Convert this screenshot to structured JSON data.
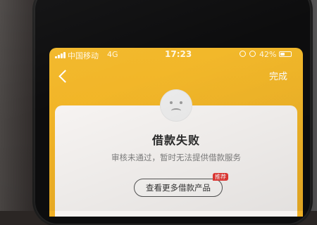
{
  "status_bar": {
    "carrier": "中国移动",
    "network": "4G",
    "time": "17:23",
    "battery_percent": "42%",
    "battery_level": 0.42
  },
  "nav": {
    "back_icon": "chevron-left",
    "done_label": "完成"
  },
  "result": {
    "icon": "sad-face",
    "title": "借款失败",
    "message": "审核未通过，暂时无法提供借款服务"
  },
  "actions": {
    "more_products_label": "查看更多借款产品",
    "badge_label": "推荐"
  },
  "colors": {
    "header": "#f2b82a",
    "card": "#f6f3f1",
    "badge": "#e53935"
  }
}
